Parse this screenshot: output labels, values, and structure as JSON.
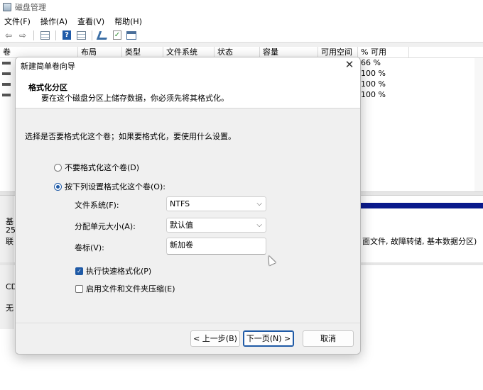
{
  "app": {
    "title": "磁盘管理"
  },
  "menu": [
    "文件(F)",
    "操作(A)",
    "查看(V)",
    "帮助(H)"
  ],
  "toolbar_icons": [
    "back-arrow-icon",
    "forward-arrow-icon",
    "list-view-icon",
    "help-icon",
    "details-view-icon",
    "connect-icon",
    "check-icon",
    "window-icon"
  ],
  "volume_table": {
    "columns": [
      "卷",
      "布局",
      "类型",
      "文件系统",
      "状态",
      "容量",
      "可用空间",
      "% 可用"
    ],
    "rows": [
      {
        "pct_free": "66 %"
      },
      {
        "pct_free": "100 %"
      },
      {
        "pct_free": "100 %"
      },
      {
        "pct_free": "100 %"
      }
    ]
  },
  "disk_pane": {
    "disk0_label": "基",
    "disk0_size": "25",
    "disk0_status": "联",
    "partition_desc": "面文件, 故障转储, 基本数据分区)",
    "disk1_label": "CD",
    "disk1_status": "无"
  },
  "dialog": {
    "title": "新建简单卷向导",
    "header_title": "格式化分区",
    "header_subtitle": "要在这个磁盘分区上储存数据，你必须先将其格式化。",
    "intro": "选择是否要格式化这个卷；如果要格式化，要使用什么设置。",
    "radio_no_format": "不要格式化这个卷(D)",
    "radio_format": "按下列设置格式化这个卷(O):",
    "fs_label": "文件系统(F):",
    "fs_value": "NTFS",
    "alloc_label": "分配单元大小(A):",
    "alloc_value": "默认值",
    "volume_label_label": "卷标(V):",
    "volume_label_value": "新加卷",
    "quick_format": "执行快速格式化(P)",
    "compression": "启用文件和文件夹压缩(E)",
    "back_button": "< 上一步(B)",
    "next_button": "下一页(N) >",
    "cancel_button": "取消"
  },
  "colors": {
    "accent": "#1f5aa6",
    "partition_bar": "#0a1a8c"
  }
}
